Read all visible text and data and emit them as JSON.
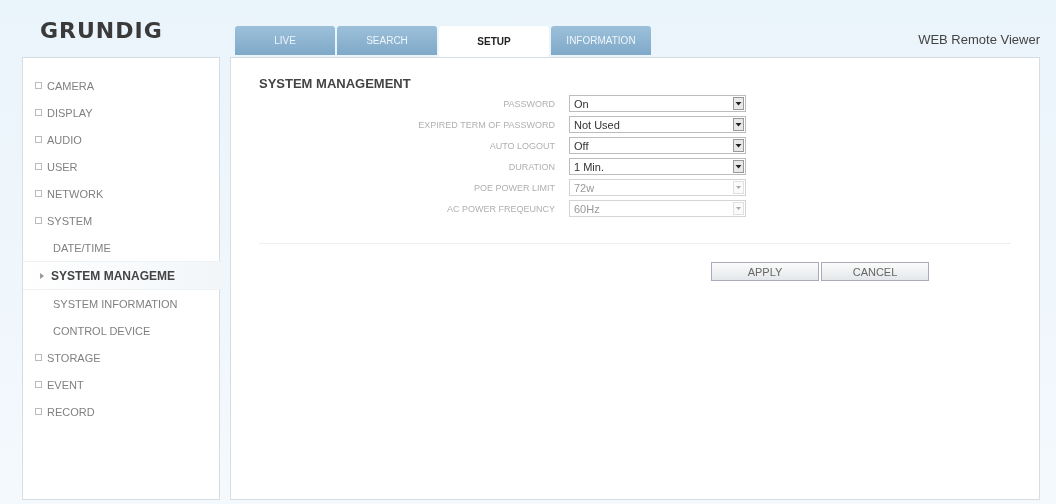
{
  "logo": "GRUNDIG",
  "tabs": [
    {
      "label": "LIVE",
      "selected": false
    },
    {
      "label": "SEARCH",
      "selected": false
    },
    {
      "label": "SETUP",
      "selected": true
    },
    {
      "label": "INFORMATION",
      "selected": false
    }
  ],
  "app_title": "WEB Remote Viewer",
  "sidebar": {
    "items": [
      {
        "label": "CAMERA",
        "selected": false
      },
      {
        "label": "DISPLAY",
        "selected": false
      },
      {
        "label": "AUDIO",
        "selected": false
      },
      {
        "label": "USER",
        "selected": false
      },
      {
        "label": "NETWORK",
        "selected": false
      },
      {
        "label": "SYSTEM",
        "selected": false,
        "children": [
          {
            "label": "DATE/TIME",
            "selected": false
          },
          {
            "label": "SYSTEM MANAGEME",
            "selected": true
          },
          {
            "label": "SYSTEM INFORMATION",
            "selected": false
          },
          {
            "label": "CONTROL DEVICE",
            "selected": false
          }
        ]
      },
      {
        "label": "STORAGE",
        "selected": false
      },
      {
        "label": "EVENT",
        "selected": false
      },
      {
        "label": "RECORD",
        "selected": false
      }
    ]
  },
  "panel": {
    "title": "SYSTEM MANAGEMENT",
    "fields": [
      {
        "label": "PASSWORD",
        "value": "On",
        "disabled": false
      },
      {
        "label": "EXPIRED TERM OF PASSWORD",
        "value": "Not Used",
        "disabled": false
      },
      {
        "label": "AUTO LOGOUT",
        "value": "Off",
        "disabled": false
      },
      {
        "label": "DURATION",
        "value": "1 Min.",
        "disabled": false
      },
      {
        "label": "POE POWER LIMIT",
        "value": "72w",
        "disabled": true
      },
      {
        "label": "AC POWER FREQEUNCY",
        "value": "60Hz",
        "disabled": true
      }
    ],
    "buttons": [
      "APPLY",
      "CANCEL"
    ]
  }
}
